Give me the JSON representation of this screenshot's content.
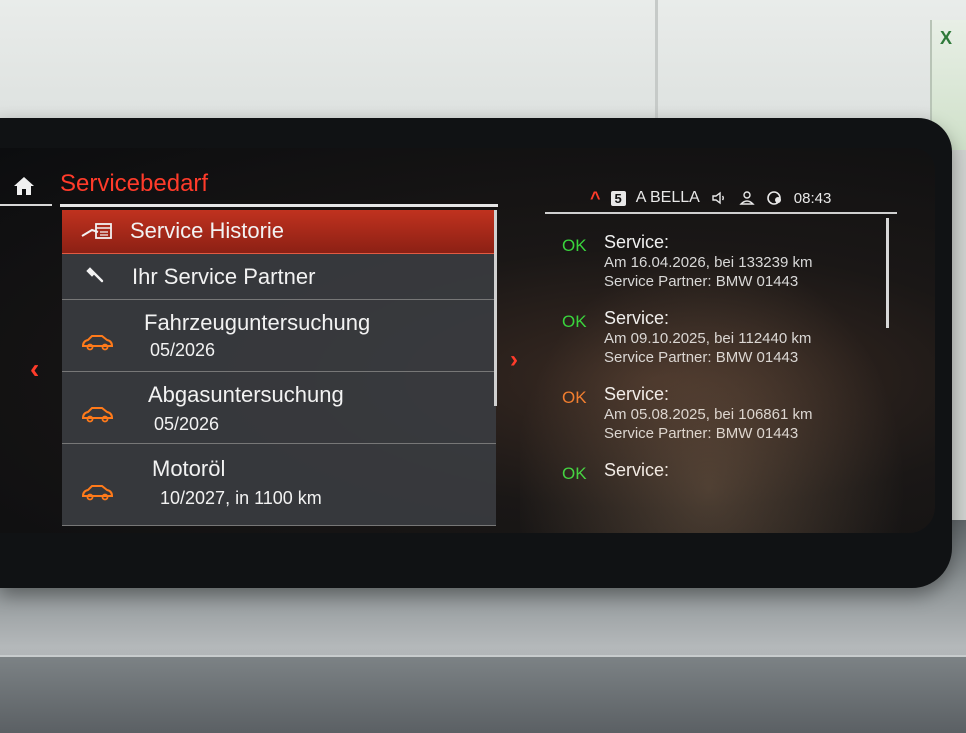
{
  "header": {
    "title": "Servicebedarf",
    "status": {
      "gear": "5",
      "station": "A BELLA",
      "time": "08:43",
      "icons": [
        "chevron-up-icon",
        "speaker-icon",
        "profile-icon",
        "network-icon"
      ]
    }
  },
  "menu": [
    {
      "label": "Service Historie",
      "icon": "service-history-icon",
      "selected": true
    },
    {
      "label": "Ihr Service Partner",
      "icon": "wrench-icon",
      "selected": false
    },
    {
      "label": "Fahrzeuguntersuchung",
      "sub": "05/2026",
      "icon": "car-icon"
    },
    {
      "label": "Abgasuntersuchung",
      "sub": "05/2026",
      "icon": "car-icon"
    },
    {
      "label": "Motoröl",
      "sub": "10/2027, in 1100 km",
      "icon": "car-icon"
    }
  ],
  "history": [
    {
      "status": "OK",
      "status_color": "#39d43c",
      "title": "Service:",
      "line1": "Am 16.04.2026, bei 133239 km",
      "line2": "Service Partner: BMW 01443"
    },
    {
      "status": "OK",
      "status_color": "#39d43c",
      "title": "Service:",
      "line1": "Am 09.10.2025, bei 112440 km",
      "line2": "Service Partner: BMW 01443"
    },
    {
      "status": "OK",
      "status_color": "#f07a2a",
      "title": "Service:",
      "line1": "Am 05.08.2025, bei 106861 km",
      "line2": "Service Partner: BMW 01443"
    },
    {
      "status": "OK",
      "status_color": "#39d43c",
      "title": "Service:",
      "line1": "",
      "line2": ""
    }
  ],
  "colors": {
    "accent": "#ff3b2a",
    "car_icon": "#ff7a1a"
  }
}
